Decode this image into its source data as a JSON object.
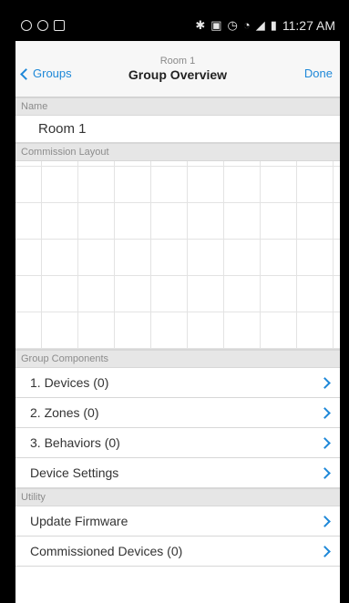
{
  "status_bar": {
    "time": "11:27 AM"
  },
  "nav": {
    "back_label": "Groups",
    "subtitle": "Room 1",
    "title": "Group Overview",
    "done_label": "Done"
  },
  "sections": {
    "name_header": "Name",
    "name_value": "Room 1",
    "layout_header": "Commission Layout",
    "components_header": "Group Components",
    "utility_header": "Utility"
  },
  "components": [
    {
      "label": "1. Devices (0)"
    },
    {
      "label": "2. Zones (0)"
    },
    {
      "label": "3. Behaviors (0)"
    },
    {
      "label": "Device Settings"
    }
  ],
  "utility": [
    {
      "label": "Update Firmware"
    },
    {
      "label": "Commissioned Devices (0)"
    }
  ],
  "colors": {
    "accent": "#1e88d8",
    "section_bg": "#e6e6e6",
    "status_bar": "#000000"
  },
  "icons": {
    "back": "chevron-left-icon",
    "row": "chevron-right-icon"
  }
}
